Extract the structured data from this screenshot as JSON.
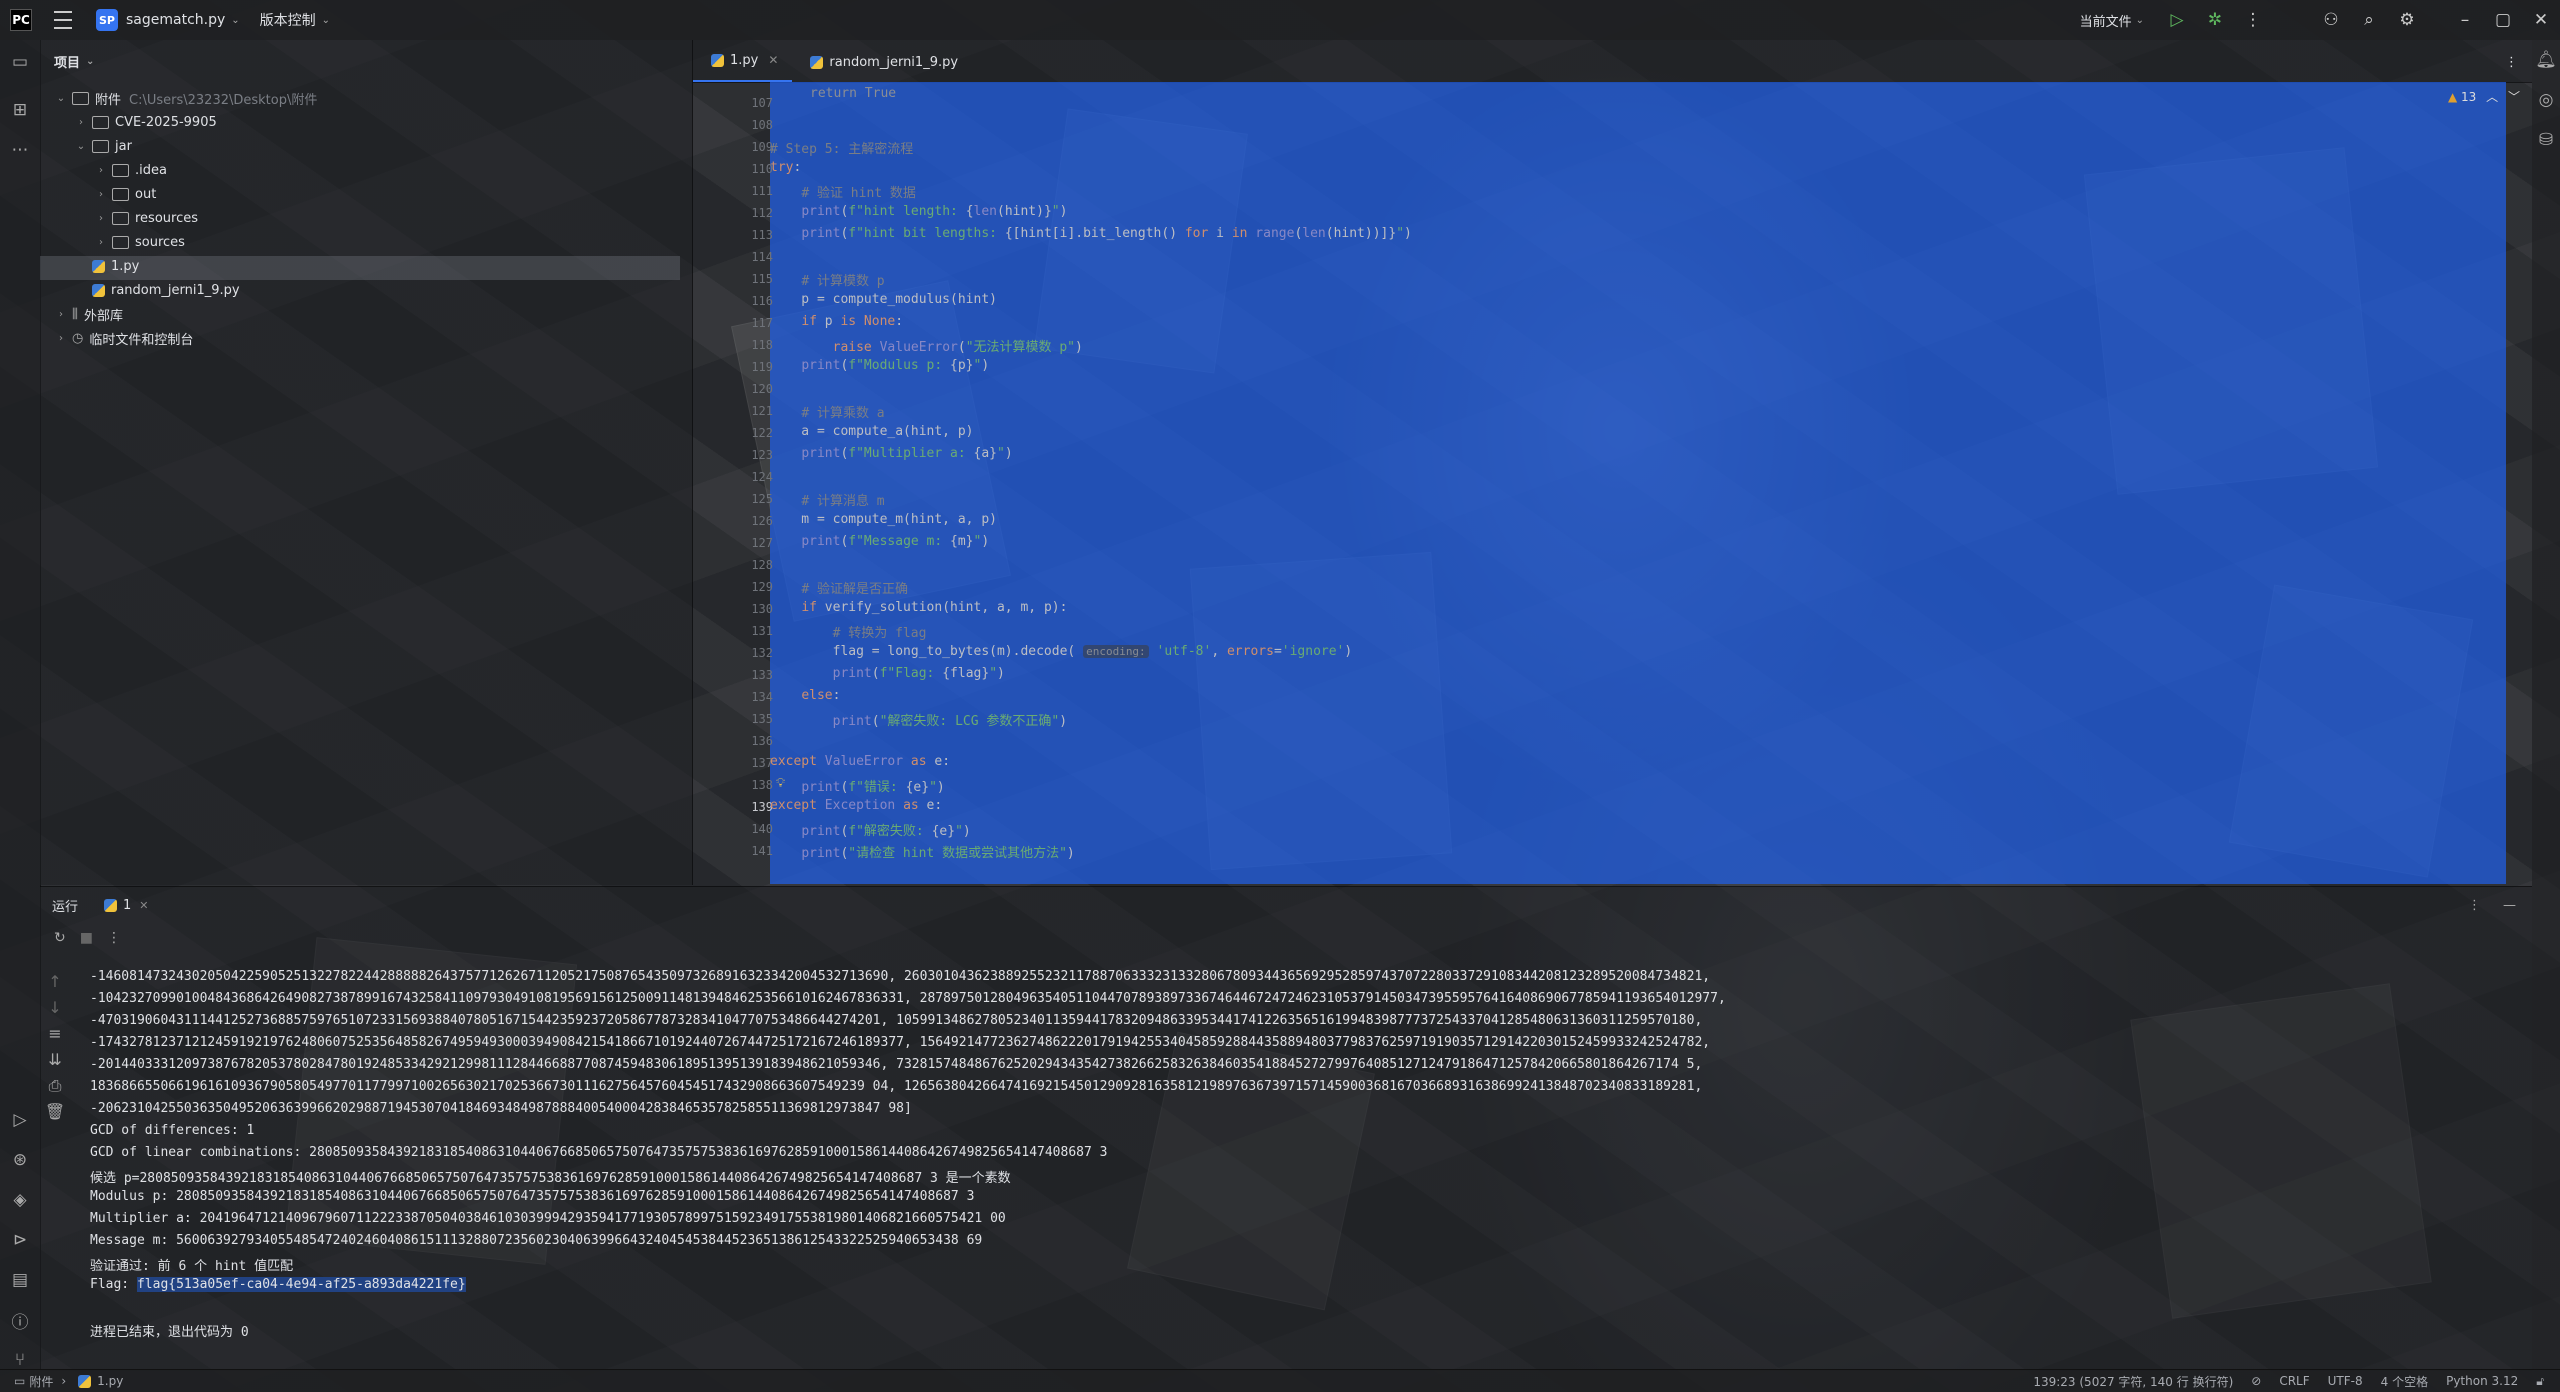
{
  "titlebar": {
    "project_badge": "SP",
    "project_name": "sagematch.py",
    "vcs": "版本控制",
    "run_config": "当前文件"
  },
  "project_panel": {
    "title": "项目",
    "root_label": "附件",
    "root_path": "C:\\Users\\23232\\Desktop\\附件",
    "items": [
      {
        "label": "CVE-2025-9905",
        "type": "folder"
      },
      {
        "label": "jar",
        "type": "folder"
      },
      {
        "label": ".idea",
        "type": "folder"
      },
      {
        "label": "out",
        "type": "folder"
      },
      {
        "label": "resources",
        "type": "folder"
      },
      {
        "label": "sources",
        "type": "folder"
      },
      {
        "label": "1.py",
        "type": "python"
      },
      {
        "label": "random_jerni1_9.py",
        "type": "python"
      },
      {
        "label": "外部库",
        "type": "library"
      },
      {
        "label": "临时文件和控制台",
        "type": "scratch"
      }
    ]
  },
  "editor": {
    "tabs": [
      {
        "label": "1.py",
        "active": true
      },
      {
        "label": "random_jerni1_9.py",
        "active": false
      }
    ],
    "warning_count": "13",
    "top_partial": "return True",
    "line_numbers": [
      "107",
      "108",
      "109",
      "110",
      "111",
      "112",
      "113",
      "114",
      "115",
      "116",
      "117",
      "118",
      "119",
      "120",
      "121",
      "122",
      "123",
      "124",
      "125",
      "126",
      "127",
      "128",
      "129",
      "130",
      "131",
      "132",
      "133",
      "134",
      "135",
      "136",
      "137",
      "138",
      "139",
      "140",
      "141"
    ],
    "current_line": "139"
  },
  "run_panel": {
    "title": "运行",
    "tab_label": "1",
    "output": [
      "-14608147324302050422590525132278224428888826437577126267112052175087654350973268916323342004532713690, 260301043623889255232117887063332313328067809344365692952859743707228033729108344208123289520084734821,",
      "-1042327099010048436864264908273878991674325841109793049108195691561250091148139484625356610162467836331, 287897501280496354051104470789389733674644672472462310537914503473955957641640869067785941193654012977,",
      "-4703190604311144125273688575976510723315693884078051671544235923720586778732834104770753486644274201, 105991348627805234011359441783209486339534417412263565161994839877737254337041285480631360311259570180,",
      "-1743278123712124591921976248060752535648582674959493000394908421541866710192440726744725172167246189377, 1564921477236274862220179194255340458592884435889480377983762597191903571291422030152459933242524782,",
      "-2014403331209738767820537802847801924853342921299811128446688770874594830618951395139183948621059346, 7328157484867625202943435427382662583263846035418845272799764085127124791864712578420665801864267174 5,",
      "183686655066196161093679058054977011779971002656302170253667301116275645760454517432908663607549239 04, 12656380426647416921545012909281635812198976367397157145900368167036689316386992413848702340833189281,",
      "-2062310425503635049520636399662029887194530704184693484987888400540004283846535782585511369812973847 98]"
    ],
    "gcd_diff": "GCD of differences: 1",
    "gcd_lin": "GCD of linear combinations: 2808509358439218318540863104406766850657507647357575383616976285910001586144086426749825654147408687 3",
    "candidate": "候选 p=2808509358439218318540863104406766850657507647357575383616976285910001586144086426749825654147408687 3 是一个素数",
    "modulus": "Modulus p: 2808509358439218318540863104406766850657507647357575383616976285910001586144086426749825654147408687 3",
    "multiplier": "Multiplier a: 2041964712140967960711222338705040384610303999429359417719305789975159234917553819801406821660575421 00",
    "message": "Message m: 5600639279340554854724024604086151113288072356023040639966432404545384452365138612543322525940653438 69",
    "verify": "验证通过: 前 6 个 hint 值匹配",
    "flag_prefix": "Flag: ",
    "flag": "flag{513a05ef-ca04-4e94-af25-a893da4221fe}",
    "exit": "进程已结束，退出代码为 0"
  },
  "statusbar": {
    "crumb_root": "附件",
    "crumb_file": "1.py",
    "position": "139:23 (5027 字符, 140 行 换行符)",
    "line_sep": "CRLF",
    "encoding": "UTF-8",
    "indent": "4 个空格",
    "interpreter": "Python 3.12"
  }
}
